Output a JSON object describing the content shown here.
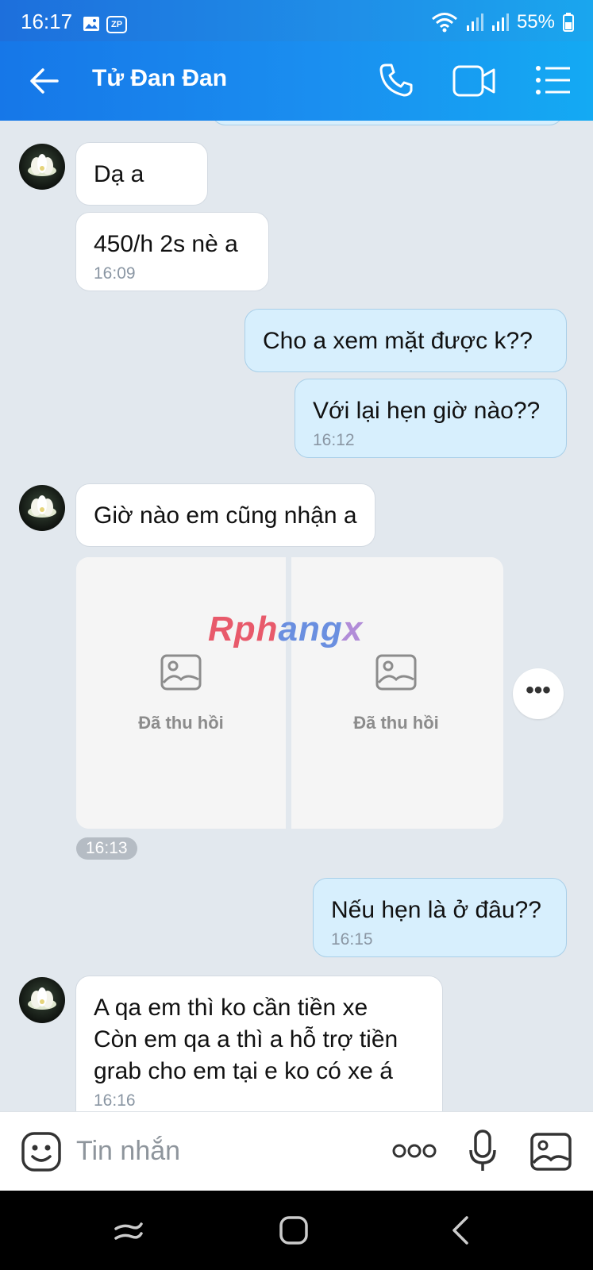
{
  "status_bar": {
    "time": "16:17",
    "notification_badge": "ZP",
    "battery_percent": "55%"
  },
  "header": {
    "title": "Tử Đan Đan",
    "icons": [
      "back-arrow-icon",
      "phone-icon",
      "video-call-icon",
      "menu-list-icon"
    ]
  },
  "messages": [
    {
      "direction": "in",
      "text": "Dạ a"
    },
    {
      "direction": "in",
      "text": "450/h 2s nè a",
      "time": "16:09"
    },
    {
      "direction": "out",
      "text": "Cho a xem mặt được k??"
    },
    {
      "direction": "out",
      "text": "Với lại hẹn giờ nào??",
      "time": "16:12"
    },
    {
      "direction": "in",
      "text": "Giờ nào em cũng nhận a"
    },
    {
      "direction": "out",
      "text": "Nếu hẹn là ở đâu??",
      "time": "16:15"
    },
    {
      "direction": "in",
      "lines": [
        "A qa em thì ko cần tiền xe",
        "Còn em qa a thì a hỗ trợ tiền",
        "grab cho em tại e ko có xe á"
      ],
      "time": "16:16"
    }
  ],
  "photo_message": {
    "tiles": [
      {
        "label": "Đã thu hồi"
      },
      {
        "label": "Đã thu hồi"
      }
    ],
    "time": "16:13"
  },
  "watermark": {
    "part1": "Rph",
    "part2": "ang",
    "part3": "x"
  },
  "input": {
    "placeholder": "Tin nhắn"
  },
  "colors": {
    "header": "#1a8ff0",
    "incoming_bubble": "#ffffff",
    "outgoing_bubble": "#d7effd",
    "chat_background": "#e2e8ee"
  }
}
